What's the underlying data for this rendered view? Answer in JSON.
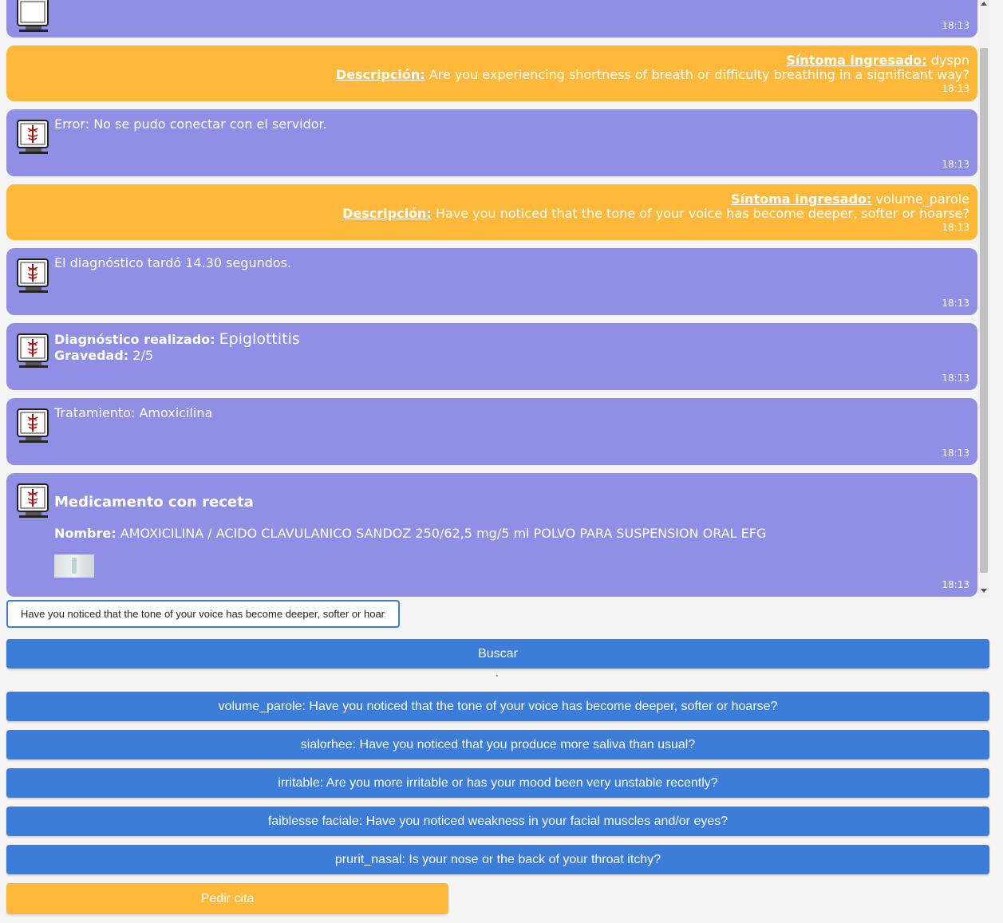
{
  "messages": [
    {
      "type": "bot",
      "time": "18:13"
    },
    {
      "type": "user",
      "symptom_label": "Síntoma ingresado:",
      "symptom": "dyspn",
      "desc_label": "Descripción:",
      "desc": "Are you experiencing shortness of breath or difficulty breathing in a significant way?",
      "time": "18:13"
    },
    {
      "type": "bot",
      "text": "Error: No se pudo conectar con el servidor.",
      "time": "18:13"
    },
    {
      "type": "user",
      "symptom_label": "Síntoma ingresado:",
      "symptom": "volume_parole",
      "desc_label": "Descripción:",
      "desc": "Have you noticed that the tone of your voice has become deeper, softer or hoarse?",
      "time": "18:13"
    },
    {
      "type": "bot",
      "text": "El diagnóstico tardó 14.30 segundos.",
      "time": "18:13"
    },
    {
      "type": "bot",
      "diag_label": "Diagnóstico realizado:",
      "diag": "Epiglottitis",
      "grav_label": "Gravedad:",
      "grav": "2/5",
      "time": "18:13"
    },
    {
      "type": "bot",
      "text": "Tratamiento: Amoxicilina",
      "time": "18:13"
    },
    {
      "type": "bot",
      "title": "Medicamento con receta",
      "name_label": "Nombre:",
      "name": "AMOXICILINA / ACIDO CLAVULANICO SANDOZ 250/62,5 mg/5 ml POLVO PARA SUSPENSION ORAL EFG",
      "time": "18:13"
    }
  ],
  "search": {
    "value": "Have you noticed that the tone of your voice has become deeper, softer or hoarse?",
    "button_label": "Buscar"
  },
  "suggestions": [
    "volume_parole: Have you noticed that the tone of your voice has become deeper, softer or hoarse?",
    "sialorhee: Have you noticed that you produce more saliva than usual?",
    "irritable: Are you more irritable or has your mood been very unstable recently?",
    "faiblesse faciale: Have you noticed weakness in your facial muscles and/or eyes?",
    "prurit_nasal: Is your nose or the back of your throat itchy?"
  ],
  "appointment_label": "Pedir cita",
  "colors": {
    "bot_bubble": "#8f8fe5",
    "user_bubble": "#ffb93a",
    "button_blue": "#3b7dd8",
    "button_orange": "#ffb93a"
  },
  "icons": {
    "avatar": "doctor-computer-icon"
  }
}
